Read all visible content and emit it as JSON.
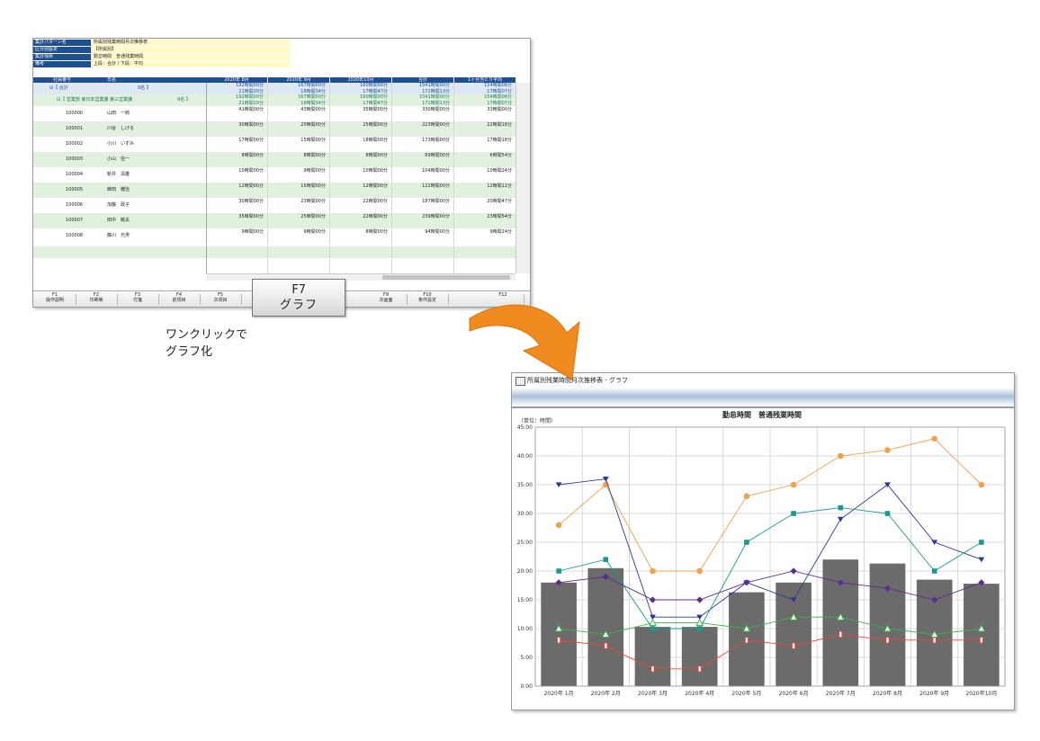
{
  "sheet": {
    "info": [
      {
        "label": "集計パターン名",
        "value": "所属別残業時間月次推移表"
      },
      {
        "label": "区分別設定",
        "value": "【所属別】"
      },
      {
        "label": "集計項目",
        "value": "勤怠時間　普通残業時間"
      },
      {
        "label": "備考",
        "value": "上段：合計 / 下段：平均"
      }
    ],
    "headers": [
      "社員番号",
      "氏名",
      "2020年 8月",
      "2020年 9月",
      "2020年10月",
      "合計",
      "1ヶ月当たり平均"
    ],
    "total_row": {
      "label": "⊟【 合計",
      "count": "9名 】",
      "top": [
        "192時間00分",
        "167時間00分",
        "160時間00分",
        "1541時間00分",
        "154時間06分"
      ],
      "bottom": [
        "21時間20分",
        "18時間34分",
        "17時間47分",
        "171時間13分",
        "17時間07分"
      ]
    },
    "group_row": {
      "label": "⊟【 営業部 東日本営業課 第三営業課",
      "count": "9名 】",
      "top": [
        "192時間00分",
        "167時間00分",
        "160時間00分",
        "1541時間00分",
        "154時間06分"
      ],
      "bottom": [
        "21時間20分",
        "18時間34分",
        "17時間47分",
        "171時間13分",
        "17時間07分"
      ]
    },
    "rows": [
      {
        "id": "100000",
        "name": "山田　一郎",
        "vals": [
          "41時間00分",
          "43時間00分",
          "35時間00分",
          "330時間00分",
          "33時間00分"
        ]
      },
      {
        "id": "100001",
        "name": "川谷　しげる",
        "vals": [
          "30時間00分",
          "20時間00分",
          "25時間00分",
          "223時間00分",
          "22時間18分"
        ]
      },
      {
        "id": "100002",
        "name": "小川　いずみ",
        "vals": [
          "17時間00分",
          "15時間00分",
          "18時間00分",
          "173時間00分",
          "17時間18分"
        ]
      },
      {
        "id": "100003",
        "name": "小山　信一",
        "vals": [
          "8時間00分",
          "8時間00分",
          "8時間00分",
          "69時間00分",
          "6時間54分"
        ]
      },
      {
        "id": "100004",
        "name": "新井　清雄",
        "vals": [
          "10時間00分",
          "9時間00分",
          "10時間00分",
          "104時間00分",
          "10時間24分"
        ]
      },
      {
        "id": "100005",
        "name": "麻田　穂治",
        "vals": [
          "12時間00分",
          "15時間00分",
          "12時間00分",
          "122時間00分",
          "12時間12分"
        ]
      },
      {
        "id": "100006",
        "name": "加藤　政子",
        "vals": [
          "30時間00分",
          "23時間00分",
          "22時間00分",
          "187時間00分",
          "20時間47分"
        ]
      },
      {
        "id": "100007",
        "name": "田中　敏夫",
        "vals": [
          "35時間00分",
          "25時間00分",
          "22時間00分",
          "239時間00分",
          "23時間54分"
        ]
      },
      {
        "id": "100008",
        "name": "藤川　光男",
        "vals": [
          "9時間00分",
          "9時間00分",
          "8時間00分",
          "94時間00分",
          "9時間24分"
        ]
      }
    ],
    "fkeys": [
      {
        "key": "F1",
        "label": "操作説明"
      },
      {
        "key": "F2",
        "label": "印刷等"
      },
      {
        "key": "F3",
        "label": "付箋"
      },
      {
        "key": "F4",
        "label": "前項目"
      },
      {
        "key": "F5",
        "label": "次項目"
      },
      {
        "key": "F9",
        "label": "次画面"
      },
      {
        "key": "F10",
        "label": "条件設定"
      },
      {
        "key": "F12",
        "label": ""
      }
    ]
  },
  "f7_button": {
    "key": "F7",
    "label": "グラフ"
  },
  "caption": {
    "line1": "ワンクリックで",
    "line2": "グラフ化"
  },
  "graph_window": {
    "title": "所属別残業時間月次推移表 - グラフ",
    "unit": "（単位：時間）",
    "chart_title": "勤怠時間　普通残業時間"
  },
  "colors": {
    "header_blue": "#1e4f8f",
    "row_green": "#e1f0df",
    "total_blue": "#dde8f3",
    "arrow": "#ef8a1f",
    "bar": "#6b6b6b"
  },
  "chart_data": {
    "type": "bar",
    "title": "勤怠時間　普通残業時間",
    "ylabel": "（単位：時間）",
    "ylim": [
      0,
      45
    ],
    "ytick_labels": [
      "0:00",
      "5:00",
      "10:00",
      "15:00",
      "20:00",
      "25:00",
      "30:00",
      "35:00",
      "40:00",
      "45:00"
    ],
    "categories": [
      "2020年 1月",
      "2020年 2月",
      "2020年 3月",
      "2020年 4月",
      "2020年 5月",
      "2020年 6月",
      "2020年 7月",
      "2020年 8月",
      "2020年 9月",
      "2020年10月"
    ],
    "grid": true,
    "series": [
      {
        "kind": "bar",
        "color": "#6b6b6b",
        "marker": "bar",
        "values": [
          18,
          20.5,
          10.3,
          10.3,
          16.3,
          18,
          22,
          21.3,
          18.5,
          17.8
        ]
      },
      {
        "kind": "line",
        "color": "#f0a050",
        "marker": "circle",
        "values": [
          28,
          35,
          20,
          20,
          33,
          35,
          40,
          41,
          43,
          35
        ]
      },
      {
        "kind": "line",
        "color": "#2b3990",
        "marker": "triangle-down",
        "values": [
          35,
          36,
          12,
          12,
          18,
          15,
          29,
          35,
          25,
          22
        ]
      },
      {
        "kind": "line",
        "color": "#1a9a8a",
        "marker": "square",
        "values": [
          20,
          22,
          10,
          10,
          25,
          30,
          31,
          30,
          20,
          25
        ]
      },
      {
        "kind": "line",
        "color": "#5b2d8e",
        "marker": "diamond",
        "values": [
          18,
          19,
          15,
          15,
          18,
          20,
          18,
          17,
          15,
          18
        ]
      },
      {
        "kind": "line",
        "color": "#3ab54a",
        "marker": "triangle-up",
        "values": [
          10,
          9,
          11,
          11,
          10,
          12,
          12,
          10,
          9,
          10
        ]
      },
      {
        "kind": "line",
        "color": "#e8453c",
        "marker": "rect",
        "values": [
          8,
          7,
          3,
          3,
          8,
          7,
          9,
          8,
          8,
          8
        ]
      }
    ]
  }
}
